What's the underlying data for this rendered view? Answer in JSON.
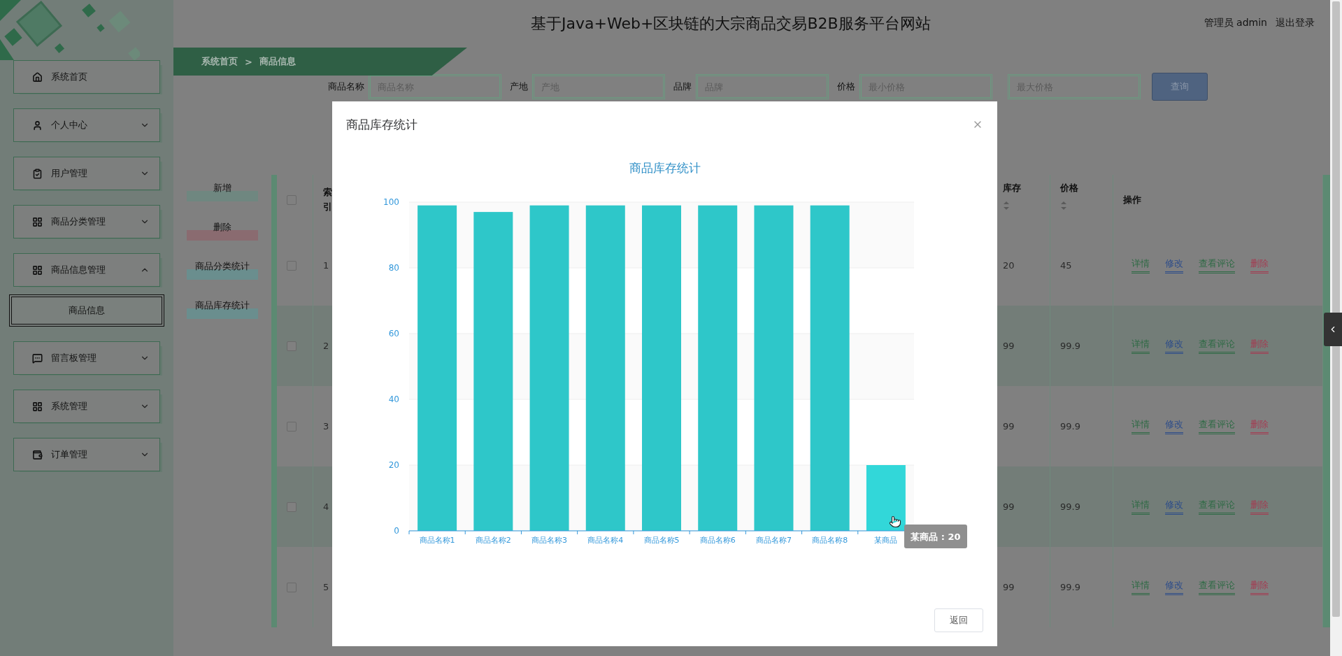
{
  "header": {
    "title": "基于Java+Web+区块链的大宗商品交易B2B服务平台网站",
    "user": "管理员 admin",
    "logout": "退出登录"
  },
  "sidebar": {
    "items": [
      {
        "label": "系统首页",
        "kind": "link"
      },
      {
        "label": "个人中心",
        "kind": "menu",
        "expanded": false
      },
      {
        "label": "用户管理",
        "kind": "menu",
        "expanded": false
      },
      {
        "label": "商品分类管理",
        "kind": "menu",
        "expanded": false
      },
      {
        "label": "商品信息管理",
        "kind": "menu",
        "expanded": true,
        "children": [
          {
            "label": "商品信息",
            "selected": true
          }
        ]
      },
      {
        "label": "留言板管理",
        "kind": "menu",
        "expanded": false
      },
      {
        "label": "系统管理",
        "kind": "menu",
        "expanded": false
      },
      {
        "label": "订单管理",
        "kind": "menu",
        "expanded": false
      }
    ]
  },
  "breadcrumb": [
    "系统首页",
    ">",
    "商品信息"
  ],
  "search": {
    "fields": [
      {
        "label": "商品名称",
        "placeholder": "商品名称"
      },
      {
        "label": "产地",
        "placeholder": "产地"
      },
      {
        "label": "品牌",
        "placeholder": "品牌"
      },
      {
        "label": "价格",
        "placeholder": "最小价格"
      },
      {
        "placeholder": "最大价格"
      }
    ],
    "button": "查询"
  },
  "actions": [
    {
      "label": "新增",
      "color": "#6f8780"
    },
    {
      "label": "删除",
      "color": "#8a6b70"
    },
    {
      "label": "商品分类统计",
      "color": "#6a8e8e"
    },
    {
      "label": "商品库存统计",
      "color": "#6a8e8e"
    }
  ],
  "table": {
    "header_checked": false,
    "columns": [
      {
        "label": "索引"
      },
      {
        "label": "库存",
        "sortable": true
      },
      {
        "label": "价格",
        "sortable": true
      },
      {
        "label": "操作"
      }
    ],
    "rows": [
      {
        "checked": false,
        "index": "1",
        "stock": "20",
        "price": "45",
        "actions": [
          {
            "label": "详情",
            "color": "#2f6a45"
          },
          {
            "label": "修改",
            "color": "#2c4c8a"
          },
          {
            "label": "查看评论",
            "color": "#2f6a45"
          },
          {
            "label": "删除",
            "color": "#a33c52"
          }
        ]
      },
      {
        "checked": false,
        "index": "2",
        "stock": "99",
        "price": "99.9",
        "actions": [
          {
            "label": "详情",
            "color": "#2f6a45"
          },
          {
            "label": "修改",
            "color": "#2c4c8a"
          },
          {
            "label": "查看评论",
            "color": "#2f6a45"
          },
          {
            "label": "删除",
            "color": "#a33c52"
          }
        ]
      },
      {
        "checked": false,
        "index": "3",
        "stock": "99",
        "price": "99.9",
        "actions": [
          {
            "label": "详情",
            "color": "#2f6a45"
          },
          {
            "label": "修改",
            "color": "#2c4c8a"
          },
          {
            "label": "查看评论",
            "color": "#2f6a45"
          },
          {
            "label": "删除",
            "color": "#a33c52"
          }
        ]
      },
      {
        "checked": false,
        "index": "4",
        "stock": "99",
        "price": "99.9",
        "actions": [
          {
            "label": "详情",
            "color": "#2f6a45"
          },
          {
            "label": "修改",
            "color": "#2c4c8a"
          },
          {
            "label": "查看评论",
            "color": "#2f6a45"
          },
          {
            "label": "删除",
            "color": "#a33c52"
          }
        ]
      },
      {
        "checked": false,
        "index": "5",
        "stock": "99",
        "price": "99.9",
        "actions": [
          {
            "label": "详情",
            "color": "#2f6a45"
          },
          {
            "label": "修改",
            "color": "#2c4c8a"
          },
          {
            "label": "查看评论",
            "color": "#2f6a45"
          },
          {
            "label": "删除",
            "color": "#a33c52"
          }
        ]
      }
    ]
  },
  "modal": {
    "title": "商品库存统计",
    "tooltip": "某商品 : 20",
    "button": "返回",
    "chart_data": {
      "type": "bar",
      "title": "商品库存统计",
      "grid": true,
      "categories": [
        "商品名称1",
        "商品名称2",
        "商品名称3",
        "商品名称4",
        "商品名称5",
        "商品名称6",
        "商品名称7",
        "商品名称8",
        "某商品"
      ],
      "series": [
        {
          "color": "#2ec7c9",
          "values": [
            99,
            97,
            99,
            99,
            99,
            99,
            99,
            99,
            20
          ]
        }
      ],
      "ylim": [
        0,
        100
      ],
      "yticks": [
        0,
        20,
        40,
        60,
        80,
        100
      ]
    }
  }
}
